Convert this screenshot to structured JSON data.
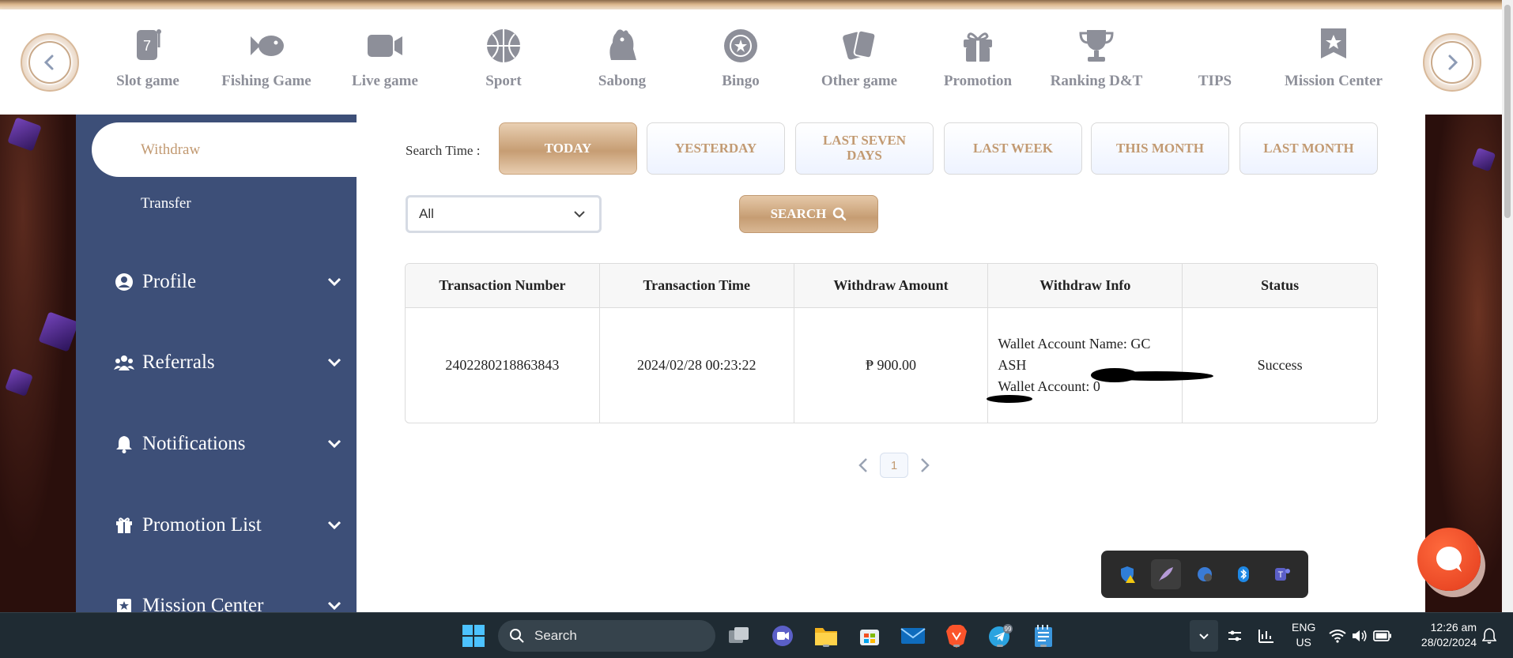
{
  "nav": {
    "items": [
      {
        "label": "Slot game",
        "icon": "slot-icon"
      },
      {
        "label": "Fishing Game",
        "icon": "fish-icon"
      },
      {
        "label": "Live game",
        "icon": "video-camera-icon"
      },
      {
        "label": "Sport",
        "icon": "basketball-icon"
      },
      {
        "label": "Sabong",
        "icon": "rooster-icon"
      },
      {
        "label": "Bingo",
        "icon": "bingo-ball-icon"
      },
      {
        "label": "Other game",
        "icon": "cards-icon"
      },
      {
        "label": "Promotion",
        "icon": "gift-icon"
      },
      {
        "label": "Ranking D&T",
        "icon": "trophy-icon"
      },
      {
        "label": "TIPS",
        "icon": "tips-icon"
      },
      {
        "label": "Mission Center",
        "icon": "star-badge-icon"
      }
    ]
  },
  "sidebar": {
    "sub_items": [
      "Withdraw",
      "Transfer"
    ],
    "active_sub": "Withdraw",
    "menus": [
      {
        "label": "Profile",
        "icon": "user-circle-icon"
      },
      {
        "label": "Referrals",
        "icon": "people-icon"
      },
      {
        "label": "Notifications",
        "icon": "bell-icon"
      },
      {
        "label": "Promotion List",
        "icon": "gift-icon"
      },
      {
        "label": "Mission Center",
        "icon": "star-badge-icon"
      }
    ]
  },
  "filters": {
    "search_time_label": "Search Time :",
    "time_buttons": [
      "TODAY",
      "YESTERDAY",
      "LAST SEVEN DAYS",
      "LAST WEEK",
      "THIS MONTH",
      "LAST MONTH"
    ],
    "active_time": "TODAY",
    "type_select": "All",
    "search_button": "SEARCH"
  },
  "table": {
    "columns": [
      "Transaction Number",
      "Transaction Time",
      "Withdraw Amount",
      "Withdraw Info",
      "Status"
    ],
    "rows": [
      {
        "number": "2402280218863843",
        "time": "2024/02/28 00:23:22",
        "amount": "₱ 900.00",
        "info_line1": "Wallet Account Name: GC ASH",
        "info_line2": "Wallet Account: 0",
        "status": "Success"
      }
    ]
  },
  "pagination": {
    "current": "1"
  },
  "taskbar": {
    "search_label": "Search",
    "language": "ENG",
    "region": "US",
    "time": "12:26 am",
    "date": "28/02/2024",
    "telegram_badge": "99"
  },
  "colors": {
    "accent_gold": "#c29a72",
    "sidebar_bg": "#3d4f78",
    "nav_icon_gray": "#8d8f99"
  }
}
